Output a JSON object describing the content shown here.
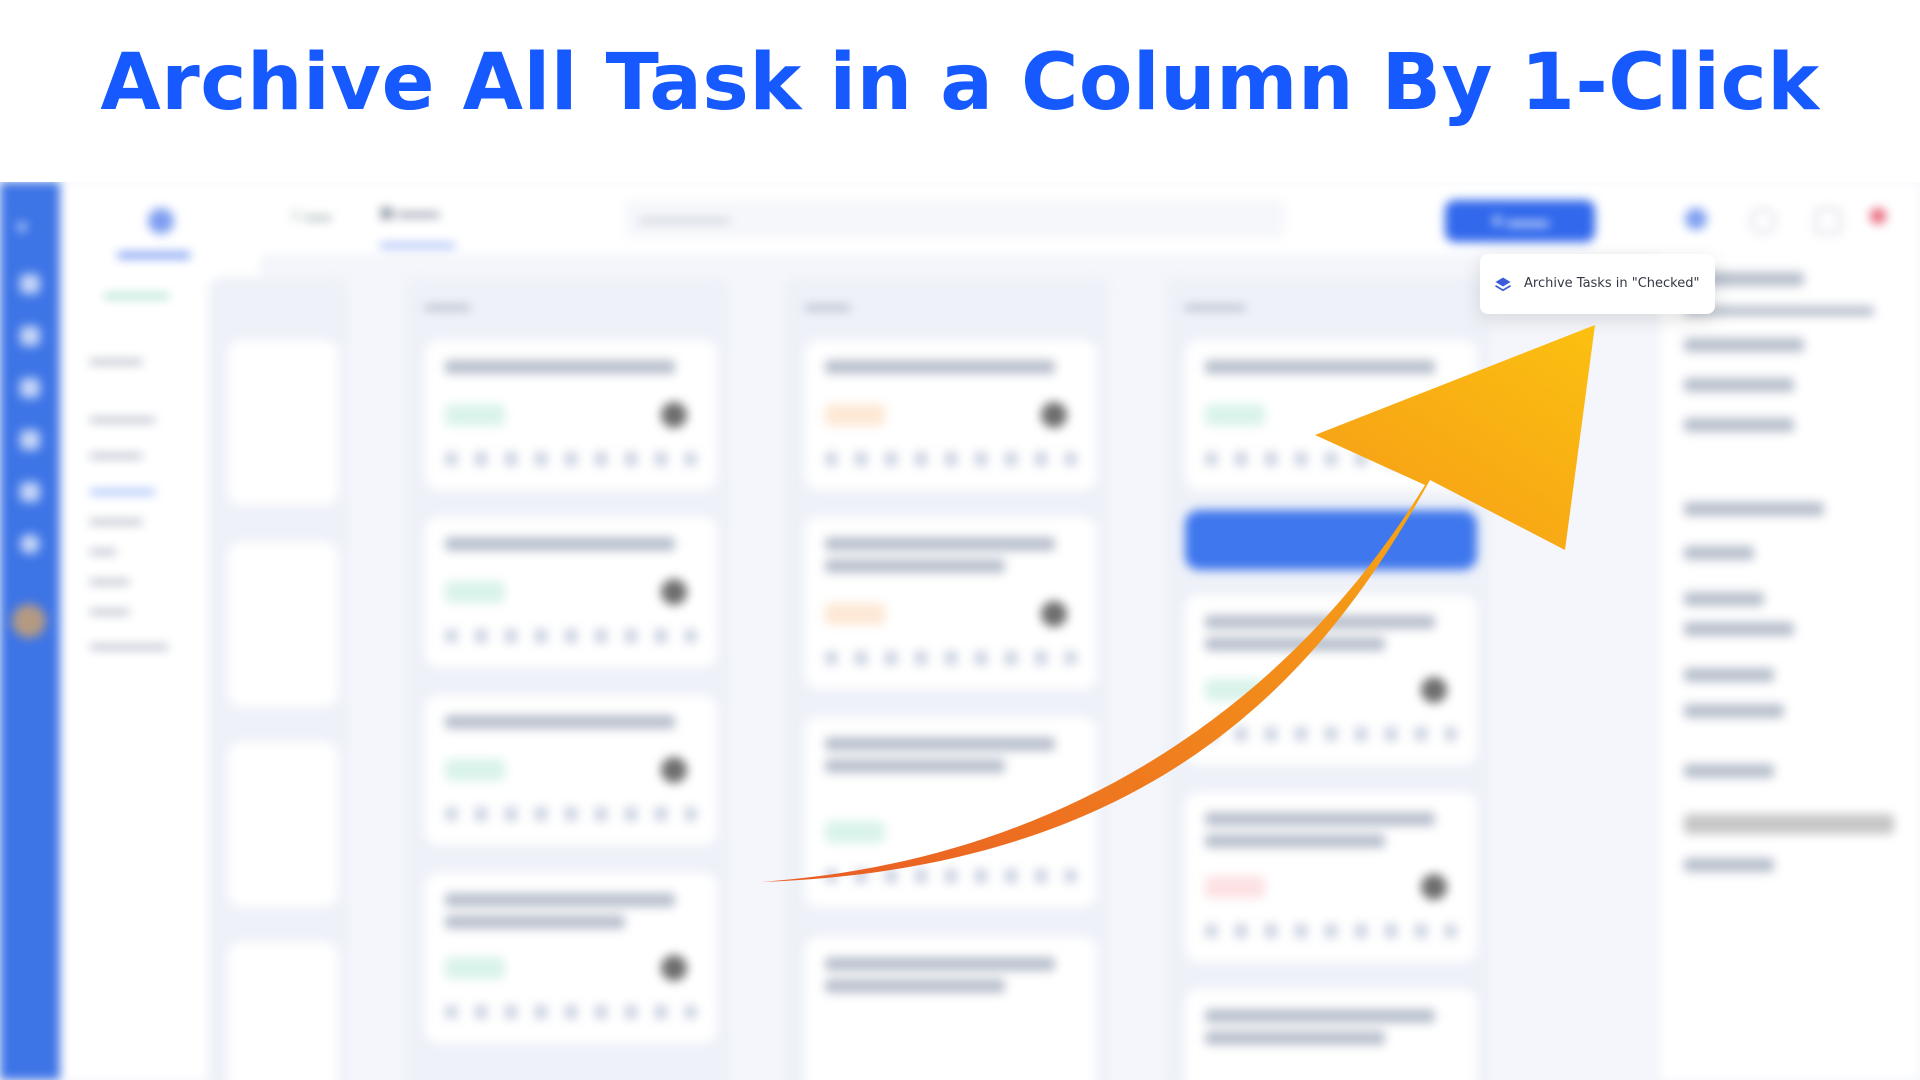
{
  "headline": "Archive All Task in a Column By 1-Click",
  "menu": {
    "archive_label": "Archive Tasks in \"Checked\""
  },
  "colors": {
    "headline": "#1559ff",
    "primary": "#3168ec",
    "arrow_start": "#e95a25",
    "arrow_end": "#fcc010"
  },
  "icons": {
    "archive": "layers-icon",
    "arrow": "curved-arrow-icon"
  }
}
